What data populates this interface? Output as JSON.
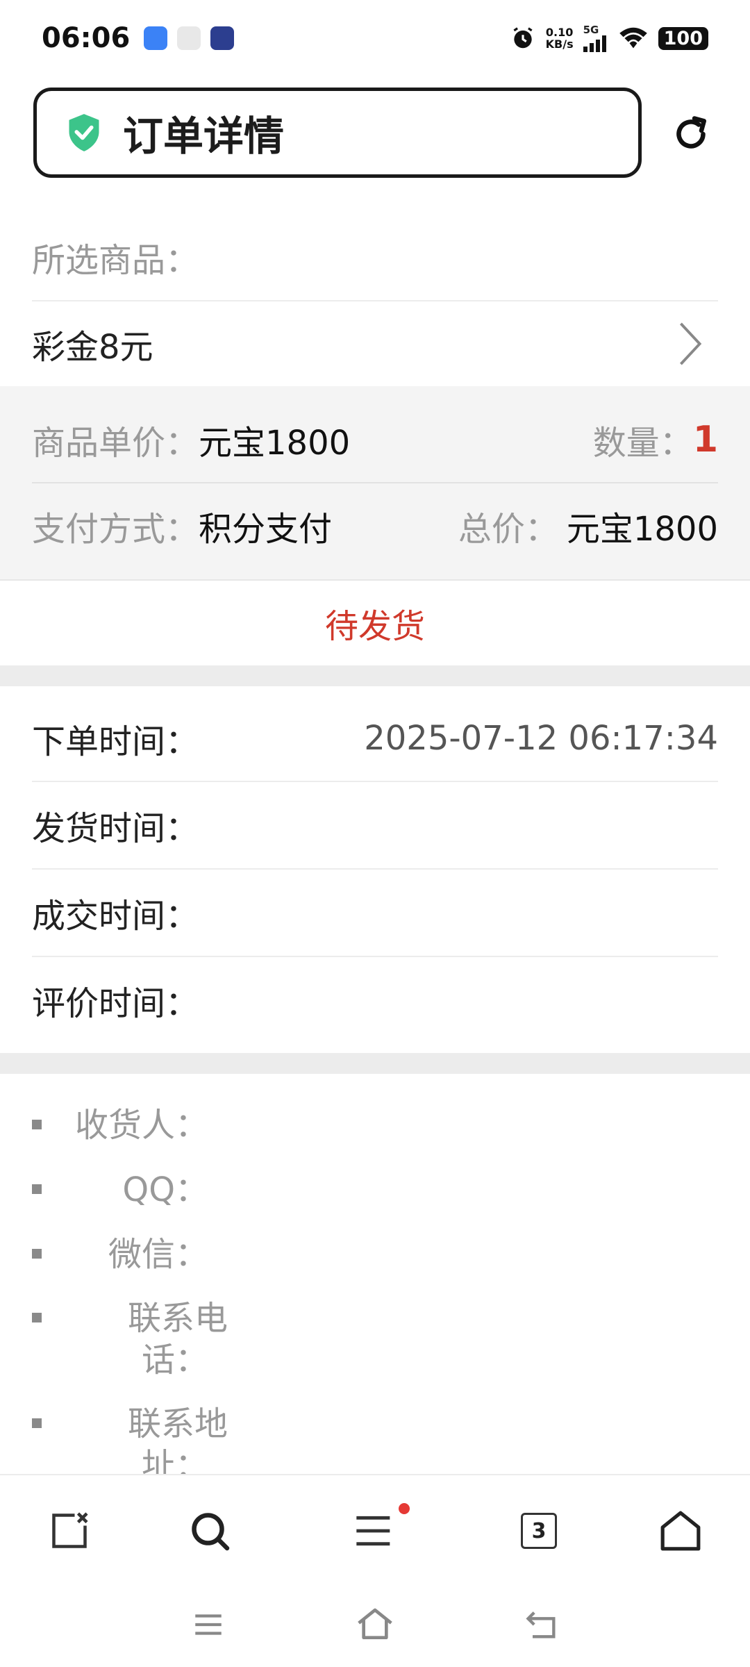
{
  "status_bar": {
    "time": "06:06",
    "net_speed_value": "0.10",
    "net_speed_unit": "KB/s",
    "network": "5G",
    "battery": "100",
    "app_icons": [
      "blue-app-icon",
      "info-app-icon",
      "news-app-icon"
    ]
  },
  "header": {
    "title": "订单详情",
    "shield_color": "#3cc48a"
  },
  "product": {
    "section_label": "所选商品：",
    "name": "彩金8元"
  },
  "pricing": {
    "unit_price_label": "商品单价：",
    "unit_price_value": "元宝1800",
    "quantity_label": "数量：",
    "quantity_value": "1",
    "payment_label": "支付方式：",
    "payment_value": "积分支付",
    "total_label": "总价：",
    "total_value": "元宝1800"
  },
  "status": {
    "text": "待发货",
    "color": "#d0392b"
  },
  "times": [
    {
      "label": "下单时间：",
      "value": "2025-07-12 06:17:34"
    },
    {
      "label": "发货时间：",
      "value": ""
    },
    {
      "label": "成交时间：",
      "value": ""
    },
    {
      "label": "评价时间：",
      "value": ""
    }
  ],
  "receiver": {
    "name_label": "收货人：",
    "qq_label": "QQ：",
    "wechat_label": "微信：",
    "phone_label_1": "联系电",
    "phone_label_2": "话：",
    "address_label_1": "联系地",
    "address_label_2": "址："
  },
  "bottom_nav": {
    "tab_count": "3",
    "notification_dot_color": "#e53935"
  }
}
